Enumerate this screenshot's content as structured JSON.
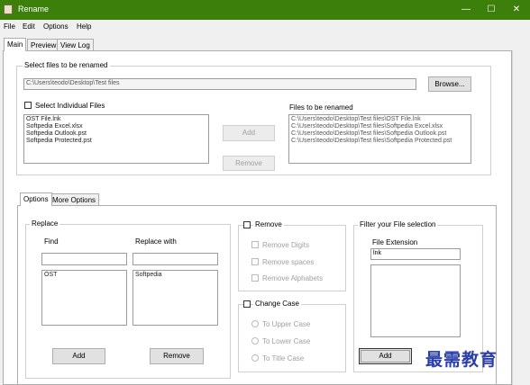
{
  "window": {
    "title": "Rename"
  },
  "menu": [
    "File",
    "Edit",
    "Options",
    "Help"
  ],
  "main_tabs": [
    "Main",
    "Preview",
    "View Log"
  ],
  "select_group": {
    "label": "Select files to be renamed",
    "path": "C:\\Users\\teodo\\Desktop\\Test files",
    "browse": "Browse...",
    "individual_label": "Select Individual Files",
    "files": [
      "OST File.lnk",
      "Softpedia Excel.xlsx",
      "Softpedia Outlook.pst",
      "Softpedia Protected.pst"
    ],
    "add": "Add",
    "remove": "Remove",
    "to_rename_label": "Files to be renamed",
    "to_rename": [
      "C:\\Users\\teodo\\Desktop\\Test files\\OST File.lnk",
      "C:\\Users\\teodo\\Desktop\\Test files\\Softpedia Excel.xlsx",
      "C:\\Users\\teodo\\Desktop\\Test files\\Softpedia Outlook.pst",
      "C:\\Users\\teodo\\Desktop\\Test files\\Softpedia Protected.pst"
    ]
  },
  "options_tabs": [
    "Options",
    "More Options"
  ],
  "replace": {
    "label": "Replace",
    "find_label": "Find",
    "with_label": "Replace with",
    "find_input": "",
    "with_input": "",
    "find_items": [
      "OST"
    ],
    "with_items": [
      "Softpedia"
    ],
    "add": "Add",
    "remove": "Remove"
  },
  "remove_group": {
    "label": "Remove",
    "options": [
      "Remove Digits",
      "Remove spaces",
      "Remove Alphabets"
    ]
  },
  "change_case": {
    "label": "Change Case",
    "options": [
      "To Upper Case",
      "To Lower Case",
      "To Title Case"
    ]
  },
  "filter": {
    "label": "Filter your File selection",
    "ext_label": "File Extension",
    "ext_value": "lnk",
    "add": "Add"
  },
  "watermark": "最需教育"
}
